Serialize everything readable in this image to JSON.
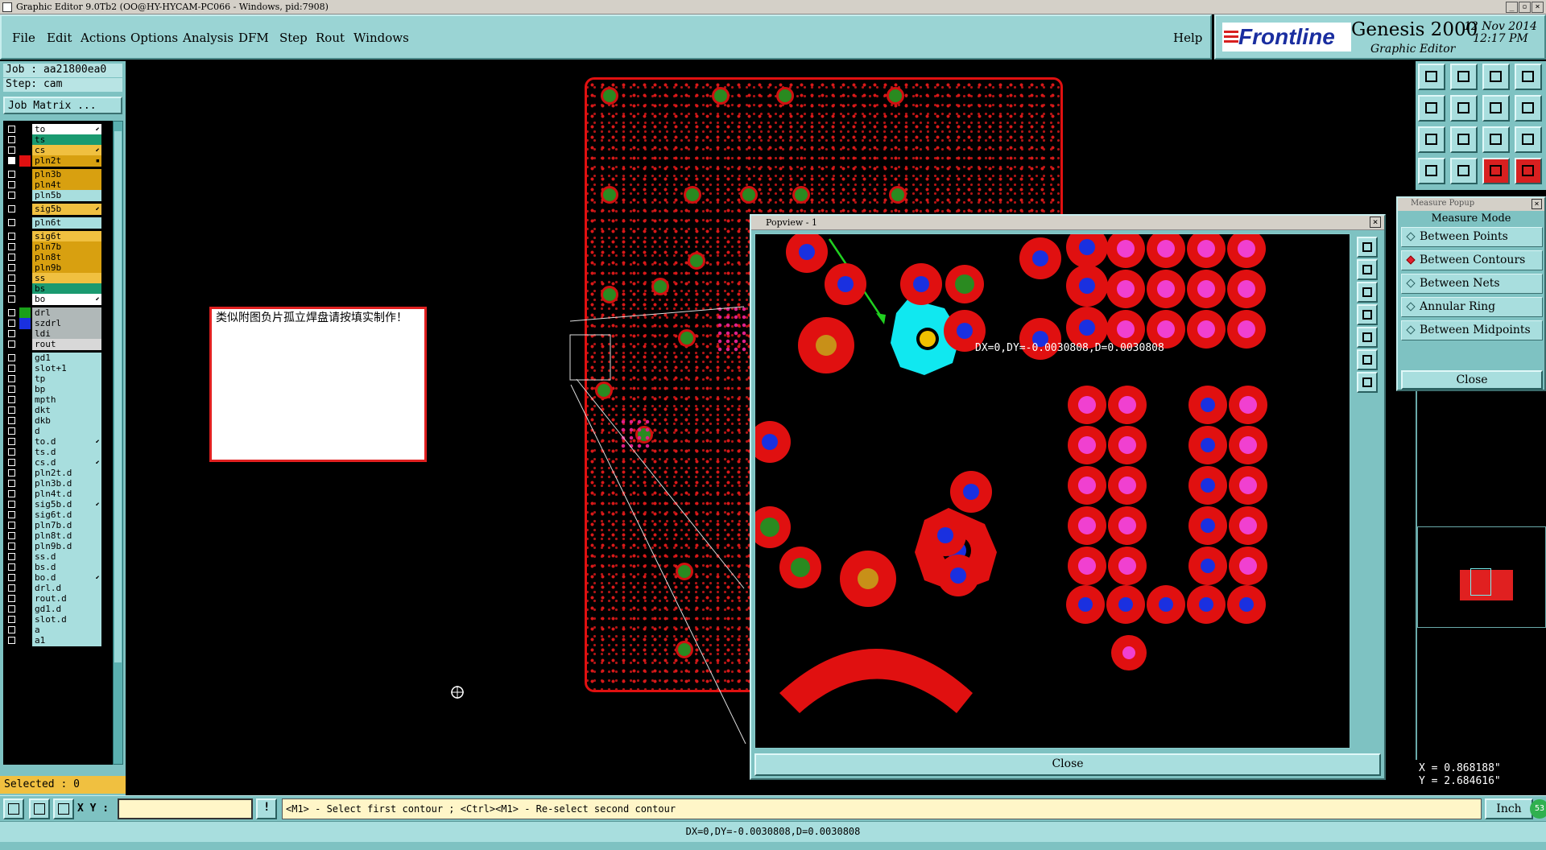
{
  "window": {
    "title": "Graphic Editor 9.0Tb2 (OO@HY-HYCAM-PC066 - Windows, pid:7908)"
  },
  "menu": {
    "items": [
      "File",
      "Edit",
      "Actions",
      "Options",
      "Analysis",
      "DFM",
      "Step",
      "Rout",
      "Windows"
    ],
    "help": "Help"
  },
  "brand": {
    "logo": "Frontline",
    "product": "Genesis 2000",
    "subtitle": "Graphic Editor",
    "date": "12 Nov 2014",
    "time": "12:17 PM"
  },
  "job": {
    "job_label": "Job : aa21800ea0",
    "step_label": "Step: cam",
    "job_matrix_button": "Job Matrix ..."
  },
  "layers": [
    {
      "name": "to",
      "color": "#ffffff",
      "flag": "⬋",
      "swatch": ""
    },
    {
      "name": "ts",
      "color": "#1a9a70",
      "flag": "",
      "swatch": ""
    },
    {
      "name": "cs",
      "color": "#f0c040",
      "flag": "⬋",
      "swatch": ""
    },
    {
      "name": "pln2t",
      "color": "#d8a010",
      "flag": "▪",
      "swatch": "#e01010",
      "checked": true
    },
    {
      "name": "pln3b",
      "color": "#d8a010",
      "flag": "",
      "swatch": ""
    },
    {
      "name": "pln4t",
      "color": "#d8a010",
      "flag": "",
      "swatch": ""
    },
    {
      "name": "pln5b",
      "color": "#a8dede",
      "flag": "",
      "swatch": ""
    },
    {
      "name": "sig5b",
      "color": "#f0c040",
      "flag": "⬋",
      "swatch": ""
    },
    {
      "name": "pln6t",
      "color": "#a8dede",
      "flag": "",
      "swatch": ""
    },
    {
      "name": "sig6t",
      "color": "#f0c040",
      "flag": "",
      "swatch": ""
    },
    {
      "name": "pln7b",
      "color": "#d8a010",
      "flag": "",
      "swatch": ""
    },
    {
      "name": "pln8t",
      "color": "#d8a010",
      "flag": "",
      "swatch": ""
    },
    {
      "name": "pln9b",
      "color": "#d8a010",
      "flag": "",
      "swatch": ""
    },
    {
      "name": "ss",
      "color": "#f0c040",
      "flag": "",
      "swatch": ""
    },
    {
      "name": "bs",
      "color": "#1a9a70",
      "flag": "",
      "swatch": ""
    },
    {
      "name": "bo",
      "color": "#ffffff",
      "flag": "⬋",
      "swatch": ""
    },
    {
      "name": "drl",
      "color": "#b0b8b8",
      "flag": "",
      "swatch": "#1aa01a"
    },
    {
      "name": "szdrl",
      "color": "#b0b8b8",
      "flag": "",
      "swatch": "#1a30e0"
    },
    {
      "name": "ldi",
      "color": "#b0b8b8",
      "flag": "",
      "swatch": ""
    },
    {
      "name": "rout",
      "color": "#d8d8d8",
      "flag": "",
      "swatch": ""
    },
    {
      "name": "gd1",
      "color": "#a8dede",
      "flag": "",
      "swatch": ""
    },
    {
      "name": "slot+1",
      "color": "#a8dede",
      "flag": "",
      "swatch": ""
    },
    {
      "name": "tp",
      "color": "#a8dede",
      "flag": "",
      "swatch": ""
    },
    {
      "name": "bp",
      "color": "#a8dede",
      "flag": "",
      "swatch": ""
    },
    {
      "name": "mpth",
      "color": "#a8dede",
      "flag": "",
      "swatch": ""
    },
    {
      "name": "dkt",
      "color": "#a8dede",
      "flag": "",
      "swatch": ""
    },
    {
      "name": "dkb",
      "color": "#a8dede",
      "flag": "",
      "swatch": ""
    },
    {
      "name": "d",
      "color": "#a8dede",
      "flag": "",
      "swatch": ""
    },
    {
      "name": "to.d",
      "color": "#a8dede",
      "flag": "⬋",
      "swatch": ""
    },
    {
      "name": "ts.d",
      "color": "#a8dede",
      "flag": "",
      "swatch": ""
    },
    {
      "name": "cs.d",
      "color": "#a8dede",
      "flag": "⬋",
      "swatch": ""
    },
    {
      "name": "pln2t.d",
      "color": "#a8dede",
      "flag": "",
      "swatch": ""
    },
    {
      "name": "pln3b.d",
      "color": "#a8dede",
      "flag": "",
      "swatch": ""
    },
    {
      "name": "pln4t.d",
      "color": "#a8dede",
      "flag": "",
      "swatch": ""
    },
    {
      "name": "sig5b.d",
      "color": "#a8dede",
      "flag": "⬋",
      "swatch": ""
    },
    {
      "name": "sig6t.d",
      "color": "#a8dede",
      "flag": "",
      "swatch": ""
    },
    {
      "name": "pln7b.d",
      "color": "#a8dede",
      "flag": "",
      "swatch": ""
    },
    {
      "name": "pln8t.d",
      "color": "#a8dede",
      "flag": "",
      "swatch": ""
    },
    {
      "name": "pln9b.d",
      "color": "#a8dede",
      "flag": "",
      "swatch": ""
    },
    {
      "name": "ss.d",
      "color": "#a8dede",
      "flag": "",
      "swatch": ""
    },
    {
      "name": "bs.d",
      "color": "#a8dede",
      "flag": "",
      "swatch": ""
    },
    {
      "name": "bo.d",
      "color": "#a8dede",
      "flag": "⬋",
      "swatch": ""
    },
    {
      "name": "drl.d",
      "color": "#a8dede",
      "flag": "",
      "swatch": ""
    },
    {
      "name": "rout.d",
      "color": "#a8dede",
      "flag": "",
      "swatch": ""
    },
    {
      "name": "gd1.d",
      "color": "#a8dede",
      "flag": "",
      "swatch": ""
    },
    {
      "name": "slot.d",
      "color": "#a8dede",
      "flag": "",
      "swatch": ""
    },
    {
      "name": "a",
      "color": "#a8dede",
      "flag": "",
      "swatch": ""
    },
    {
      "name": "a1",
      "color": "#a8dede",
      "flag": "",
      "swatch": ""
    }
  ],
  "selected_label": "Selected : 0",
  "note": {
    "text": "类似附图负片孤立焊盘请按填实制作！"
  },
  "popview": {
    "title": "Popview - 1",
    "measure_text": "DX=0,DY=-0.0030808,D=0.0030808",
    "close_label": "Close"
  },
  "measure_popup": {
    "title": "Measure Popup",
    "header": "Measure Mode",
    "options": [
      "Between Points",
      "Between Contours",
      "Between Nets",
      "Annular Ring",
      "Between Midpoints"
    ],
    "selected": "Between Contours",
    "close_label": "Close"
  },
  "coords": {
    "x": "X = 0.868188\"",
    "y": "Y = 2.684616\""
  },
  "statusbar": {
    "xy_label": "X Y :",
    "xy_value": "",
    "prompt": "<M1> - Select first contour ; <Ctrl><M1> - Re-select second contour",
    "unit": "Inch",
    "result": "DX=0,DY=-0.0030808,D=0.0030808",
    "badge": "53"
  },
  "colors": {
    "panel": "#7ec2c2",
    "board_red": "#e01010",
    "pad_blue": "#1a30e0",
    "pad_magenta": "#f040d0",
    "highlight_cyan": "#10e8f0"
  }
}
